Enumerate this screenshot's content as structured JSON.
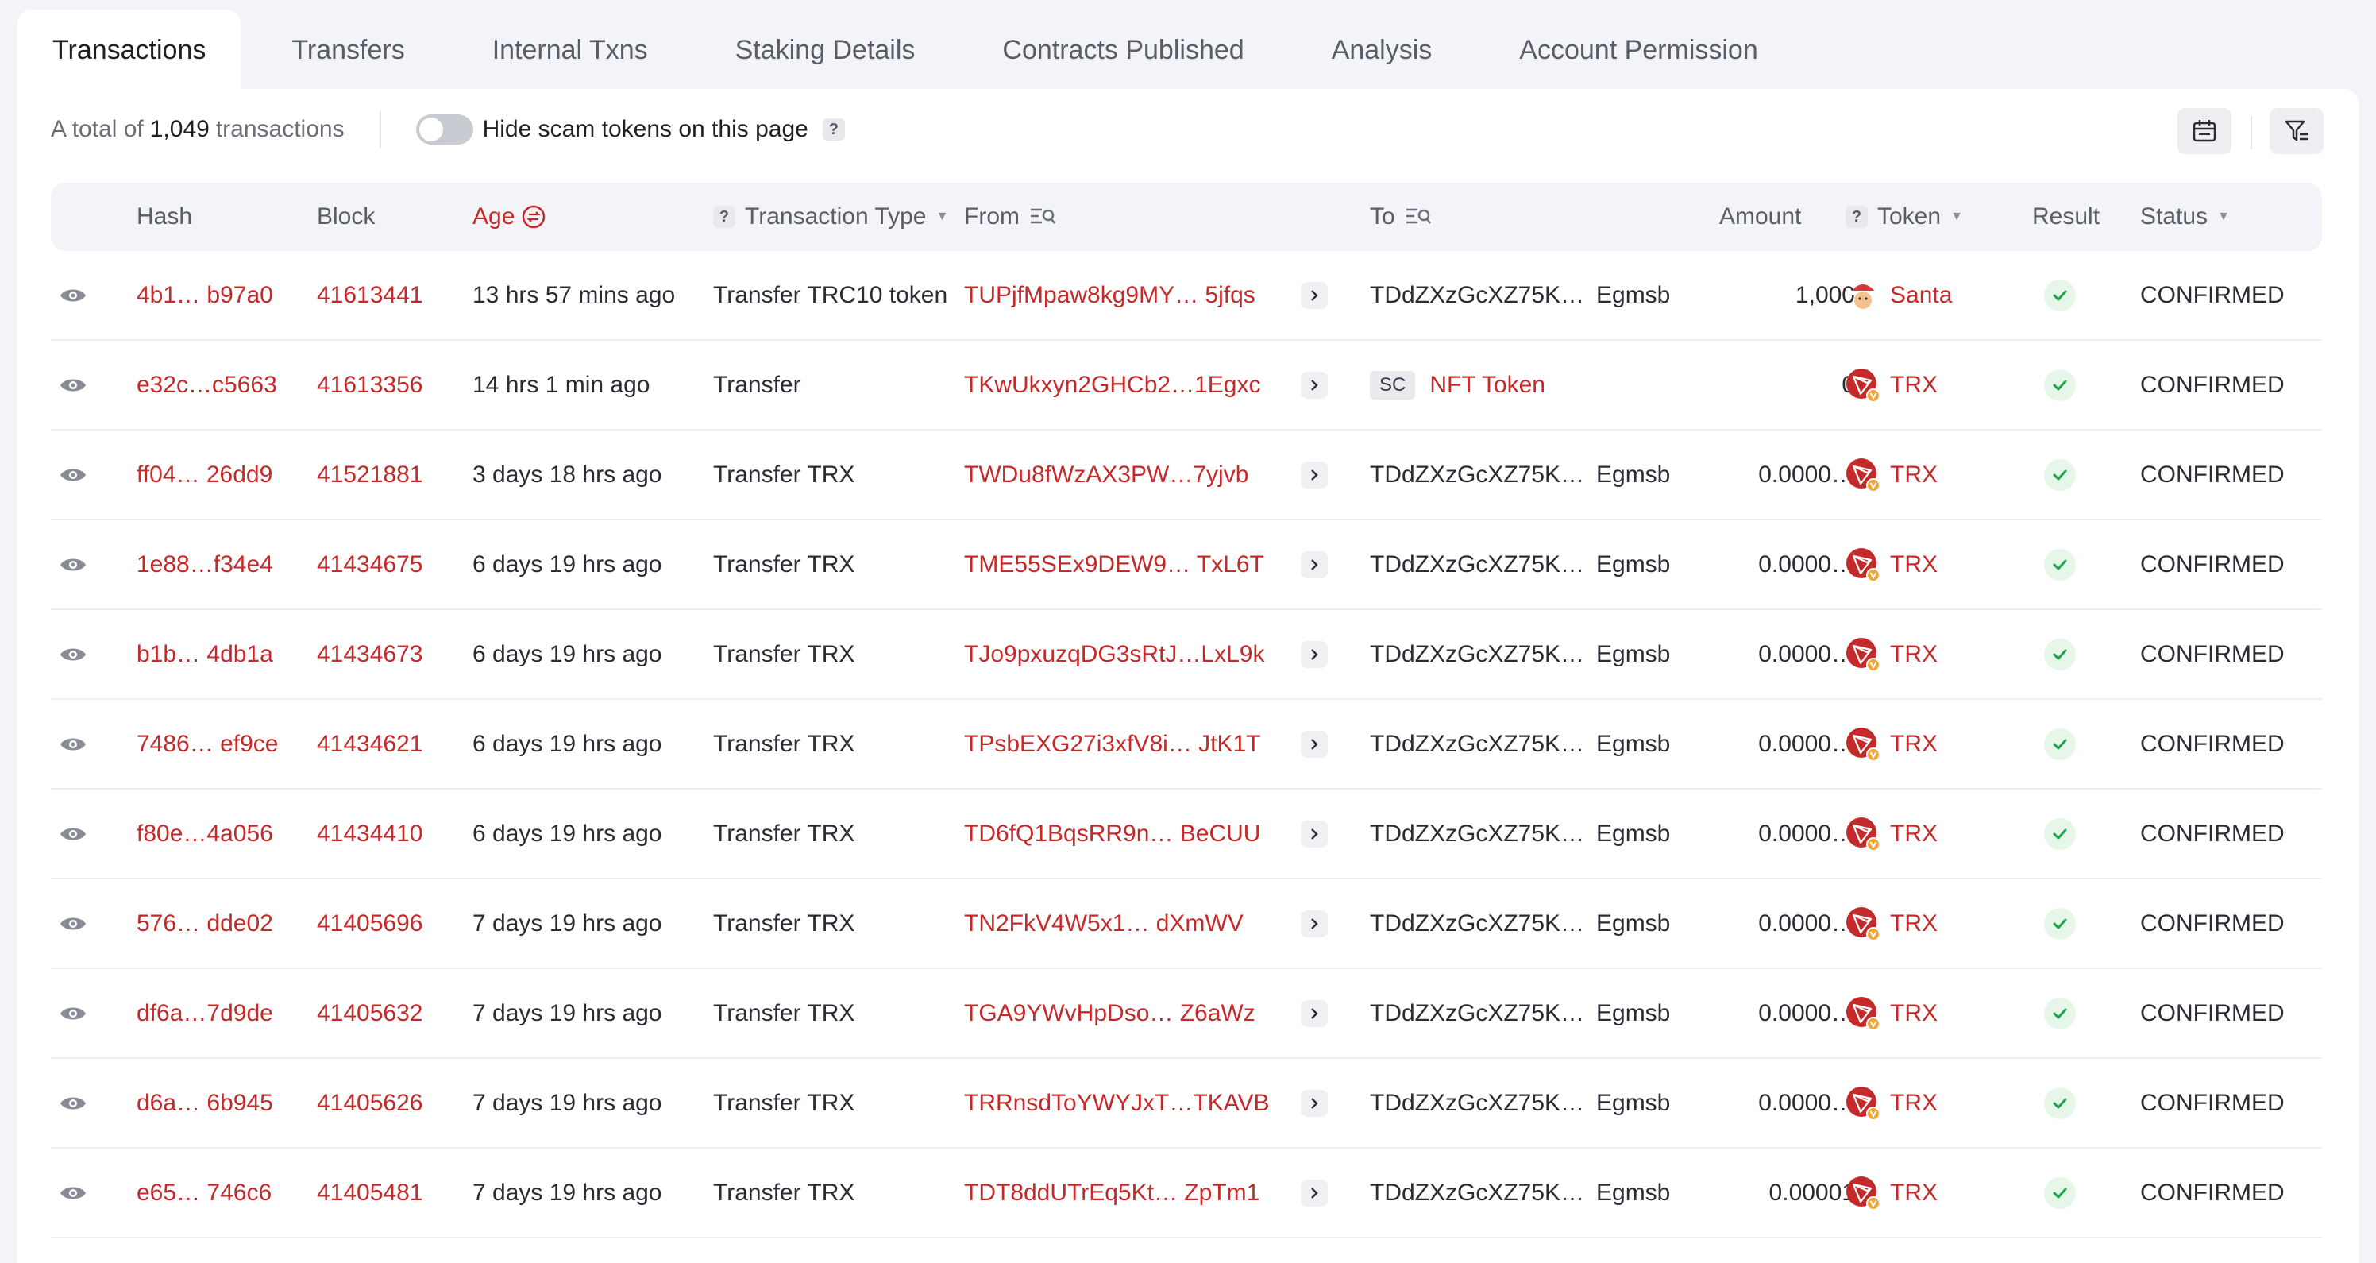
{
  "tabs": [
    {
      "label": "Transactions",
      "active": true
    },
    {
      "label": "Transfers"
    },
    {
      "label": "Internal Txns"
    },
    {
      "label": "Staking Details"
    },
    {
      "label": "Contracts Published"
    },
    {
      "label": "Analysis"
    },
    {
      "label": "Account Permission"
    }
  ],
  "summary": {
    "prefix": "A total of",
    "count": "1,049",
    "suffix": "transactions",
    "toggle_label": "Hide scam tokens on this page",
    "help": "?"
  },
  "toolbar": {
    "calendar_icon": "calendar-icon",
    "filter_icon": "filter-icon"
  },
  "columns": {
    "hash": "Hash",
    "block": "Block",
    "age": "Age",
    "type_help": "?",
    "type": "Transaction Type",
    "from": "From",
    "to": "To",
    "amount": "Amount",
    "token_help": "?",
    "token": "Token",
    "result": "Result",
    "status": "Status"
  },
  "colors": {
    "accent": "#c42a2a",
    "success": "#1aa34a",
    "header_bg": "#f3f4f7"
  },
  "rows": [
    {
      "hash": "4b1… b97a0",
      "block": "41613441",
      "age": "13 hrs 57 mins ago",
      "type": "Transfer TRC10 token",
      "from": "TUPjfMpaw8kg9MY… 5jfqs",
      "to": "TDdZXzGcXZ75K…",
      "to_suffix": "Egmsb",
      "amount": "1,000",
      "token": "Santa",
      "token_icon": "santa-token-icon",
      "status": "CONFIRMED"
    },
    {
      "hash": "e32c…c5663",
      "block": "41613356",
      "age": "14 hrs 1 min ago",
      "type": "Transfer",
      "from": "TKwUkxyn2GHCb2…1Egxc",
      "to_badge": "SC",
      "to_link": "NFT Token",
      "amount": "0",
      "token": "TRX",
      "token_icon": "trx-icon",
      "status": "CONFIRMED"
    },
    {
      "hash": "ff04… 26dd9",
      "block": "41521881",
      "age": "3 days 18 hrs ago",
      "type": "Transfer TRX",
      "from": "TWDu8fWzAX3PW…7yjvb",
      "to": "TDdZXzGcXZ75K…",
      "to_suffix": "Egmsb",
      "amount": "0.0000…",
      "token": "TRX",
      "token_icon": "trx-icon",
      "status": "CONFIRMED"
    },
    {
      "hash": "1e88…f34e4",
      "block": "41434675",
      "age": "6 days 19 hrs ago",
      "type": "Transfer TRX",
      "from": "TME55SEx9DEW9… TxL6T",
      "to": "TDdZXzGcXZ75K…",
      "to_suffix": "Egmsb",
      "amount": "0.0000…",
      "token": "TRX",
      "token_icon": "trx-icon",
      "status": "CONFIRMED"
    },
    {
      "hash": "b1b… 4db1a",
      "block": "41434673",
      "age": "6 days 19 hrs ago",
      "type": "Transfer TRX",
      "from": "TJo9pxuzqDG3sRtJ…LxL9k",
      "to": "TDdZXzGcXZ75K…",
      "to_suffix": "Egmsb",
      "amount": "0.0000…",
      "token": "TRX",
      "token_icon": "trx-icon",
      "status": "CONFIRMED"
    },
    {
      "hash": "7486… ef9ce",
      "block": "41434621",
      "age": "6 days 19 hrs ago",
      "type": "Transfer TRX",
      "from": "TPsbEXG27i3xfV8i… JtK1T",
      "to": "TDdZXzGcXZ75K…",
      "to_suffix": "Egmsb",
      "amount": "0.0000…",
      "token": "TRX",
      "token_icon": "trx-icon",
      "status": "CONFIRMED"
    },
    {
      "hash": "f80e…4a056",
      "block": "41434410",
      "age": "6 days 19 hrs ago",
      "type": "Transfer TRX",
      "from": "TD6fQ1BqsRR9n… BeCUU",
      "to": "TDdZXzGcXZ75K…",
      "to_suffix": "Egmsb",
      "amount": "0.0000…",
      "token": "TRX",
      "token_icon": "trx-icon",
      "status": "CONFIRMED"
    },
    {
      "hash": "576… dde02",
      "block": "41405696",
      "age": "7 days 19 hrs ago",
      "type": "Transfer TRX",
      "from": "TN2FkV4W5x1… dXmWV",
      "to": "TDdZXzGcXZ75K…",
      "to_suffix": "Egmsb",
      "amount": "0.0000…",
      "token": "TRX",
      "token_icon": "trx-icon",
      "status": "CONFIRMED"
    },
    {
      "hash": "df6a…7d9de",
      "block": "41405632",
      "age": "7 days 19 hrs ago",
      "type": "Transfer TRX",
      "from": "TGA9YWvHpDso… Z6aWz",
      "to": "TDdZXzGcXZ75K…",
      "to_suffix": "Egmsb",
      "amount": "0.0000…",
      "token": "TRX",
      "token_icon": "trx-icon",
      "status": "CONFIRMED"
    },
    {
      "hash": "d6a… 6b945",
      "block": "41405626",
      "age": "7 days 19 hrs ago",
      "type": "Transfer TRX",
      "from": "TRRnsdToYWYJxT…TKAVB",
      "to": "TDdZXzGcXZ75K…",
      "to_suffix": "Egmsb",
      "amount": "0.0000…",
      "token": "TRX",
      "token_icon": "trx-icon",
      "status": "CONFIRMED"
    },
    {
      "hash": "e65… 746c6",
      "block": "41405481",
      "age": "7 days 19 hrs ago",
      "type": "Transfer TRX",
      "from": "TDT8ddUTrEq5Kt… ZpTm1",
      "to": "TDdZXzGcXZ75K…",
      "to_suffix": "Egmsb",
      "amount": "0.00001",
      "token": "TRX",
      "token_icon": "trx-icon",
      "status": "CONFIRMED"
    }
  ]
}
